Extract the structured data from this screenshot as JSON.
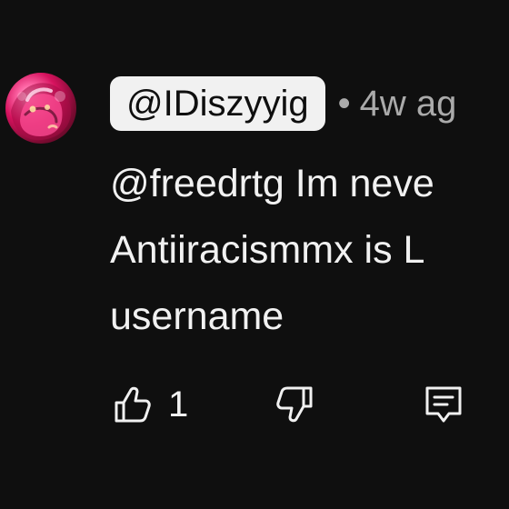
{
  "comment": {
    "author_handle": "@IDiszyyig",
    "separator": "•",
    "timestamp": "4w ag",
    "text_lines": [
      "@freedrtg Im neve",
      "Antiiracismmx is L",
      "username"
    ]
  },
  "actions": {
    "like_count": "1"
  },
  "icons": {
    "avatar": "avatar-image",
    "like": "thumbs-up-icon",
    "dislike": "thumbs-down-icon",
    "reply": "comment-icon"
  },
  "colors": {
    "background": "#0f0f0f",
    "text": "#f1f1f1",
    "secondary_text": "#aaaaaa",
    "handle_pill_bg": "#f1f1f1",
    "handle_pill_text": "#0f0f0f"
  }
}
